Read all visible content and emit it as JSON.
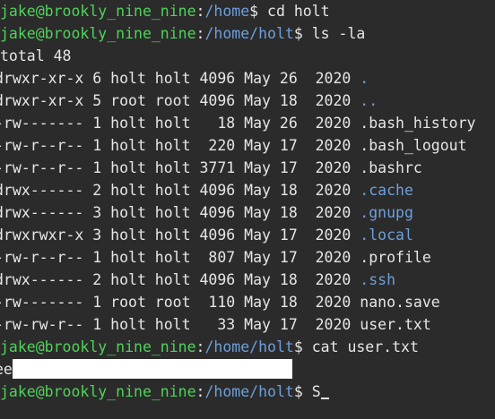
{
  "prompt": {
    "user_host": "jake@brookly_nine_nine",
    "separator": ":",
    "dollar": "$ "
  },
  "lines": [
    {
      "path": "/home",
      "command": "cd holt"
    },
    {
      "path": "/home/holt",
      "command": "ls -la"
    }
  ],
  "total": "total 48",
  "listing": [
    {
      "perms": "drwxr-xr-x",
      "links": "6",
      "owner": "holt",
      "group": "holt",
      "size": "4096",
      "month": "May",
      "day": "26",
      "year": "2020",
      "name": ".",
      "is_dir": true
    },
    {
      "perms": "drwxr-xr-x",
      "links": "5",
      "owner": "root",
      "group": "root",
      "size": "4096",
      "month": "May",
      "day": "18",
      "year": "2020",
      "name": "..",
      "is_dir": true
    },
    {
      "perms": "-rw-------",
      "links": "1",
      "owner": "holt",
      "group": "holt",
      "size": "18",
      "month": "May",
      "day": "26",
      "year": "2020",
      "name": ".bash_history",
      "is_dir": false
    },
    {
      "perms": "-rw-r--r--",
      "links": "1",
      "owner": "holt",
      "group": "holt",
      "size": "220",
      "month": "May",
      "day": "17",
      "year": "2020",
      "name": ".bash_logout",
      "is_dir": false
    },
    {
      "perms": "-rw-r--r--",
      "links": "1",
      "owner": "holt",
      "group": "holt",
      "size": "3771",
      "month": "May",
      "day": "17",
      "year": "2020",
      "name": ".bashrc",
      "is_dir": false
    },
    {
      "perms": "drwx------",
      "links": "2",
      "owner": "holt",
      "group": "holt",
      "size": "4096",
      "month": "May",
      "day": "18",
      "year": "2020",
      "name": ".cache",
      "is_dir": true
    },
    {
      "perms": "drwx------",
      "links": "3",
      "owner": "holt",
      "group": "holt",
      "size": "4096",
      "month": "May",
      "day": "18",
      "year": "2020",
      "name": ".gnupg",
      "is_dir": true
    },
    {
      "perms": "drwxrwxr-x",
      "links": "3",
      "owner": "holt",
      "group": "holt",
      "size": "4096",
      "month": "May",
      "day": "17",
      "year": "2020",
      "name": ".local",
      "is_dir": true
    },
    {
      "perms": "-rw-r--r--",
      "links": "1",
      "owner": "holt",
      "group": "holt",
      "size": "807",
      "month": "May",
      "day": "17",
      "year": "2020",
      "name": ".profile",
      "is_dir": false
    },
    {
      "perms": "drwx------",
      "links": "2",
      "owner": "holt",
      "group": "holt",
      "size": "4096",
      "month": "May",
      "day": "18",
      "year": "2020",
      "name": ".ssh",
      "is_dir": true
    },
    {
      "perms": "-rw-------",
      "links": "1",
      "owner": "root",
      "group": "root",
      "size": "110",
      "month": "May",
      "day": "18",
      "year": "2020",
      "name": "nano.save",
      "is_dir": false
    },
    {
      "perms": "-rw-rw-r--",
      "links": "1",
      "owner": "holt",
      "group": "holt",
      "size": "33",
      "month": "May",
      "day": "17",
      "year": "2020",
      "name": "user.txt",
      "is_dir": false
    }
  ],
  "cat_line": {
    "path": "/home/holt",
    "command": "cat user.txt"
  },
  "cat_output_prefix": "ee",
  "last_line": {
    "path": "/home/holt",
    "typed": "S"
  },
  "colors": {
    "background": "#2b2b2b",
    "text": "#e6e6e6",
    "user_host": "#4fd35a",
    "path": "#6d9fdc",
    "directory": "#6d9fdc"
  }
}
